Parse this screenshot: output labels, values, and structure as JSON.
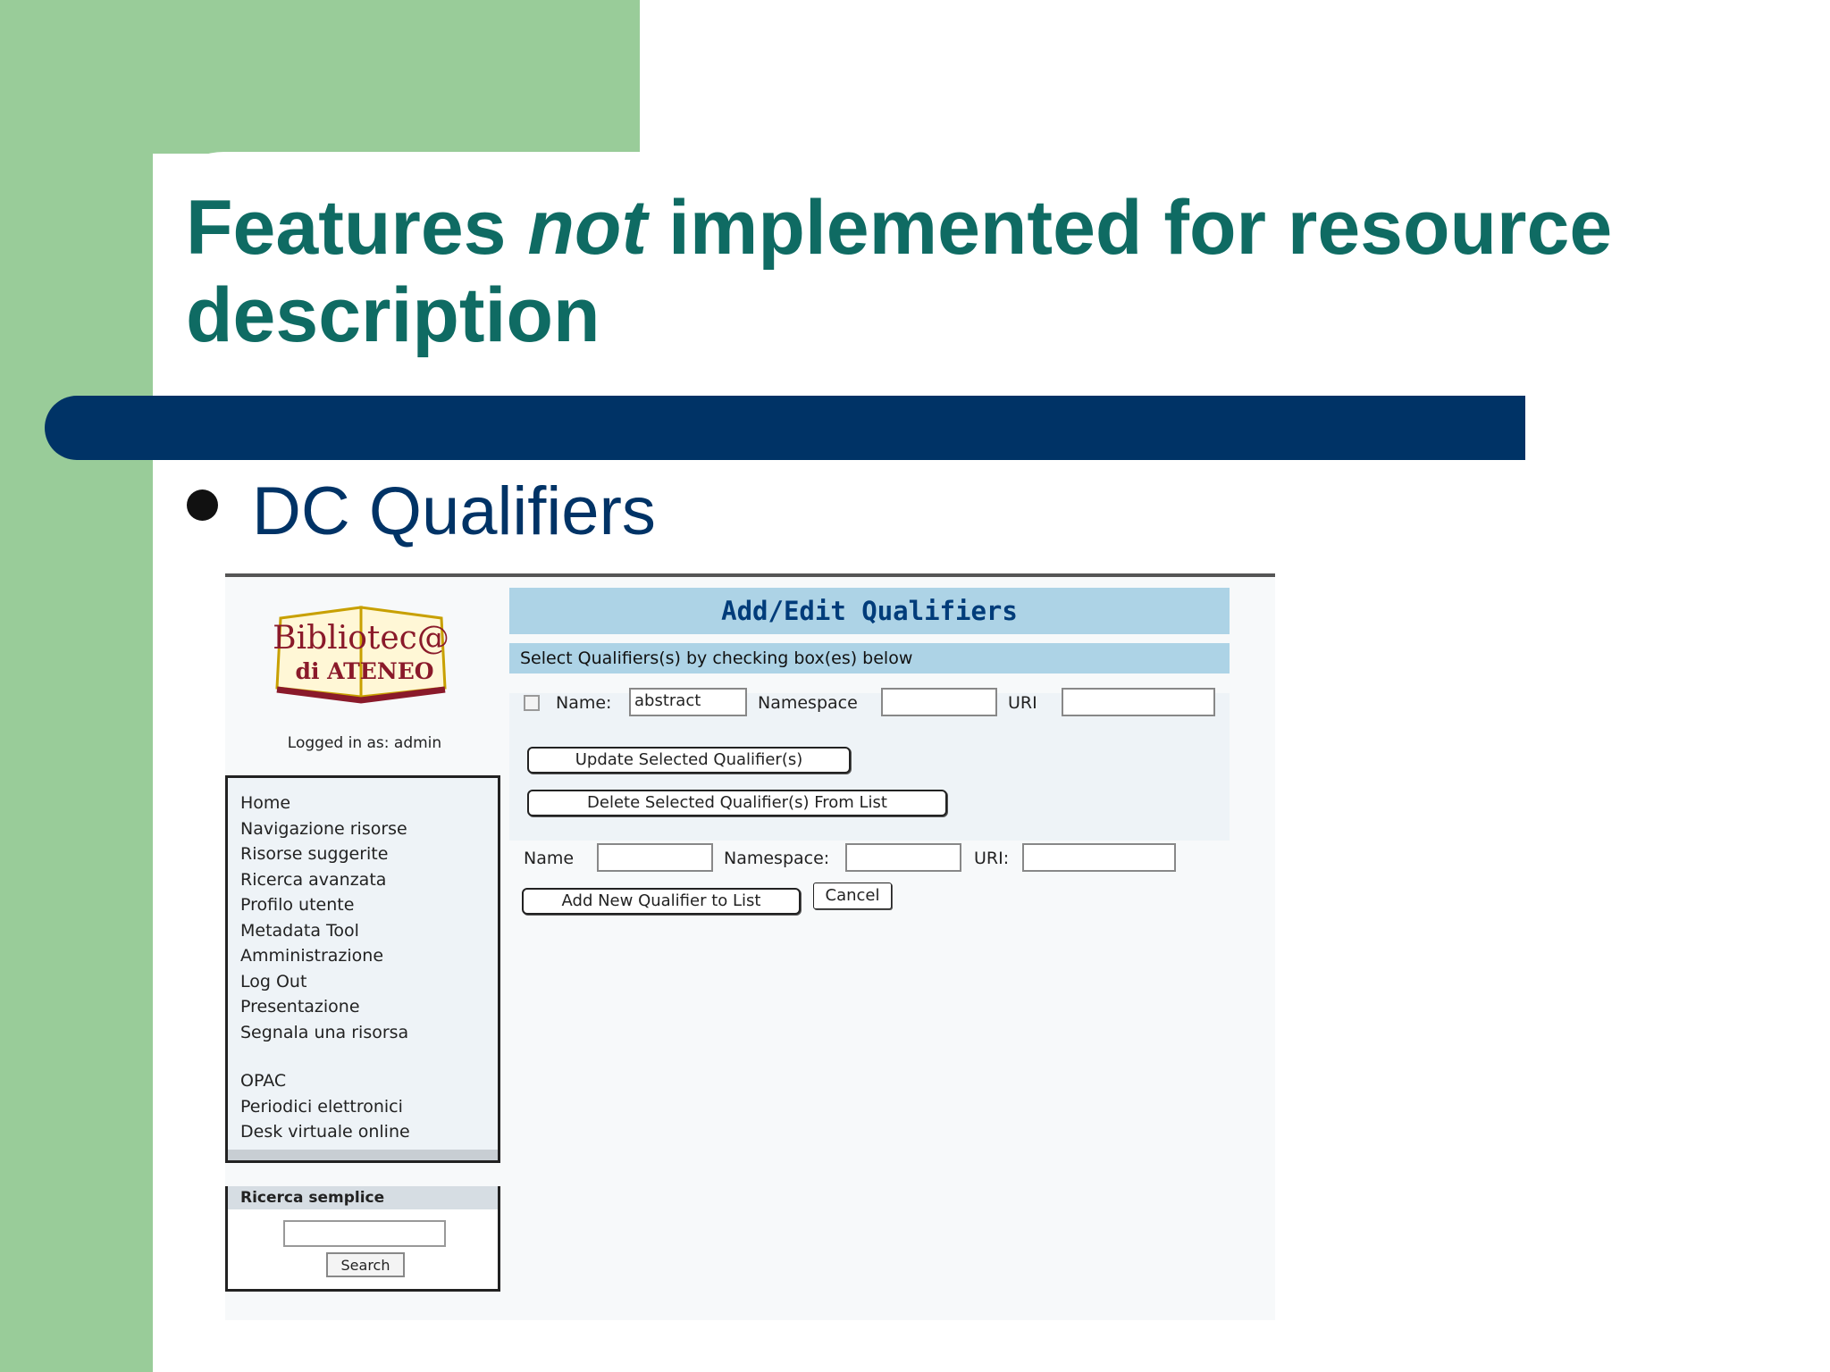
{
  "slide": {
    "title_before": "Features ",
    "title_em": "not",
    "title_after": " implemented for resource description",
    "bullet": "DC Qualifiers"
  },
  "colors": {
    "green": "#99cc99",
    "title": "#0f6b63",
    "band": "#003366",
    "bullet_text": "#003366",
    "header_blue": "#add3e6"
  },
  "screenshot": {
    "logo": {
      "line1": "Bibliotec@",
      "line2": "di ATENEO"
    },
    "logged_in": "Logged in as: admin",
    "nav_items": [
      "Home",
      "Navigazione risorse",
      "Risorse suggerite",
      "Ricerca avanzata",
      "Profilo utente",
      "Metadata Tool",
      "Amministrazione",
      "Log Out",
      "Presentazione",
      "Segnala una risorsa",
      "OPAC",
      "Periodici elettronici",
      "Desk virtuale online"
    ],
    "search": {
      "heading": "Ricerca semplice",
      "button": "Search"
    },
    "main": {
      "title": "Add/Edit Qualifiers",
      "instruction": "Select Qualifiers(s) by checking box(es) below",
      "existing": {
        "name_label": "Name:",
        "name_value": "abstract",
        "namespace_label": "Namespace",
        "uri_label": "URI"
      },
      "update_button": "Update Selected Qualifier(s)",
      "delete_button": "Delete Selected Qualifier(s) From List",
      "new": {
        "name_label": "Name",
        "namespace_label": "Namespace:",
        "uri_label": "URI:"
      },
      "add_button": "Add New Qualifier to List",
      "cancel_button": "Cancel"
    }
  }
}
